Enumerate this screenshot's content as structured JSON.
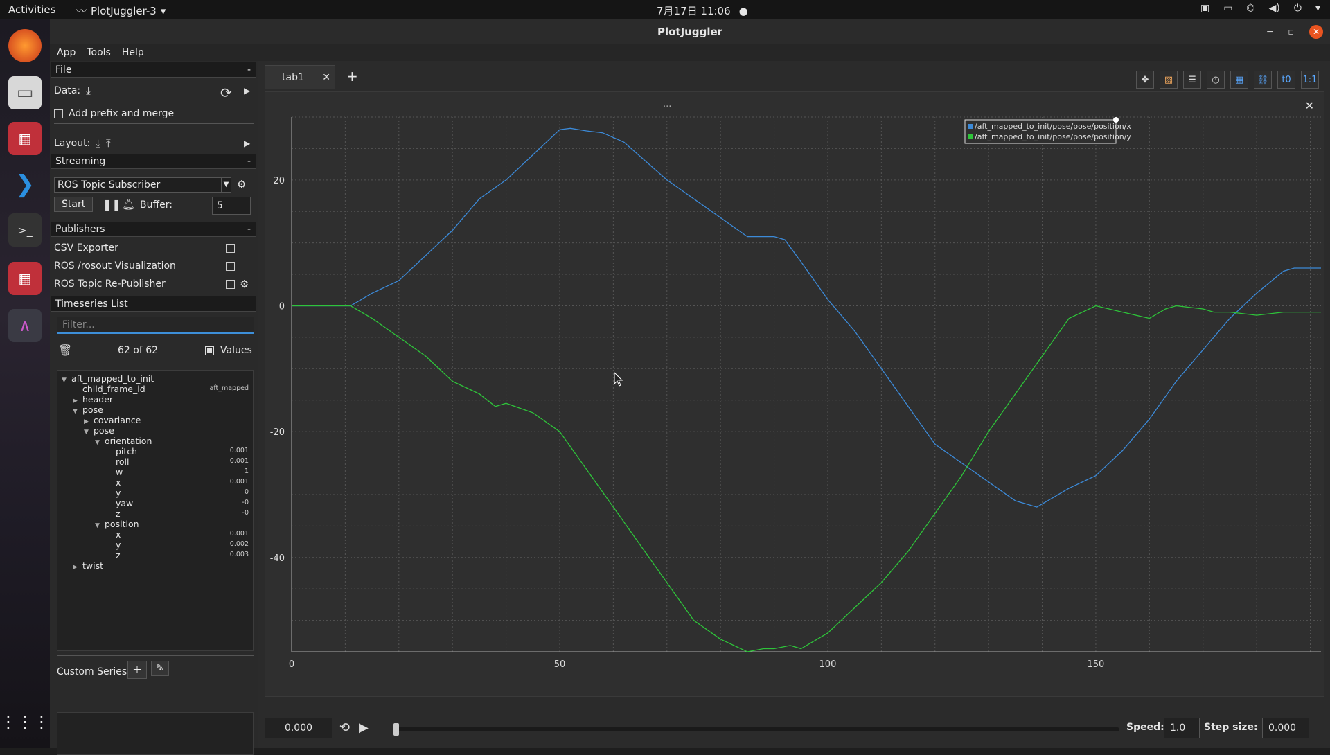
{
  "topbar": {
    "activities": "Activities",
    "app_name": "PlotJuggler-3",
    "clock": "7月17日 11:06"
  },
  "window": {
    "title": "PlotJuggler"
  },
  "menu": [
    "App",
    "Tools",
    "Help"
  ],
  "file_section": {
    "title": "File",
    "collapse": "-",
    "data_label": "Data:",
    "prefix_label": "Add prefix and merge",
    "layout_label": "Layout:"
  },
  "streaming": {
    "title": "Streaming",
    "collapse": "-",
    "source": "ROS Topic Subscriber",
    "start_label": "Start",
    "buffer_label": "Buffer:",
    "buffer_value": "5"
  },
  "publishers": {
    "title": "Publishers",
    "collapse": "-",
    "items": [
      "CSV Exporter",
      "ROS /rosout Visualization",
      "ROS Topic Re-Publisher"
    ]
  },
  "timeseries": {
    "title": "Timeseries List",
    "filter_placeholder": "Filter...",
    "count": "62 of 62",
    "values_label": "Values"
  },
  "tree": [
    {
      "label": "aft_mapped_to_init",
      "level": 0,
      "arrow": "v",
      "value": ""
    },
    {
      "label": "child_frame_id",
      "level": 1,
      "arrow": "",
      "value": "aft_mapped"
    },
    {
      "label": "header",
      "level": 1,
      "arrow": ">",
      "value": ""
    },
    {
      "label": "pose",
      "level": 1,
      "arrow": "v",
      "value": ""
    },
    {
      "label": "covariance",
      "level": 2,
      "arrow": ">",
      "value": ""
    },
    {
      "label": "pose",
      "level": 2,
      "arrow": "v",
      "value": ""
    },
    {
      "label": "orientation",
      "level": 3,
      "arrow": "v",
      "value": ""
    },
    {
      "label": "pitch",
      "level": 4,
      "arrow": "",
      "value": "0.001"
    },
    {
      "label": "roll",
      "level": 4,
      "arrow": "",
      "value": "0.001"
    },
    {
      "label": "w",
      "level": 4,
      "arrow": "",
      "value": "1"
    },
    {
      "label": "x",
      "level": 4,
      "arrow": "",
      "value": "0.001"
    },
    {
      "label": "y",
      "level": 4,
      "arrow": "",
      "value": "0"
    },
    {
      "label": "yaw",
      "level": 4,
      "arrow": "",
      "value": "-0"
    },
    {
      "label": "z",
      "level": 4,
      "arrow": "",
      "value": "-0"
    },
    {
      "label": "position",
      "level": 3,
      "arrow": "v",
      "value": ""
    },
    {
      "label": "x",
      "level": 4,
      "arrow": "",
      "value": "0.001"
    },
    {
      "label": "y",
      "level": 4,
      "arrow": "",
      "value": "0.002"
    },
    {
      "label": "z",
      "level": 4,
      "arrow": "",
      "value": "0.003"
    },
    {
      "label": "twist",
      "level": 1,
      "arrow": ">",
      "value": ""
    }
  ],
  "custom_series": {
    "label": "Custom Series:"
  },
  "tabs": [
    {
      "label": "tab1"
    }
  ],
  "plot_title": "...",
  "chart_data": {
    "type": "line",
    "xlim": [
      0,
      192
    ],
    "ylim": [
      -55,
      30
    ],
    "xticks": [
      0,
      50,
      100,
      150
    ],
    "yticks": [
      20,
      0,
      -20,
      -40
    ],
    "grid": true,
    "legend": "top-right",
    "series": [
      {
        "name": "/aft_mapped_to_init/pose/pose/position/x",
        "color": "#3c8ad8",
        "x": [
          0,
          11,
          15,
          20,
          25,
          30,
          35,
          40,
          45,
          50,
          52,
          55,
          58,
          62,
          70,
          80,
          85,
          90,
          92,
          95,
          100,
          105,
          110,
          115,
          120,
          125,
          130,
          135,
          139,
          145,
          150,
          155,
          160,
          165,
          170,
          175,
          180,
          185,
          187,
          192
        ],
        "y": [
          0,
          0,
          2,
          4,
          8,
          12,
          17,
          20,
          24,
          28,
          28.2,
          27.8,
          27.5,
          26,
          20,
          14,
          11,
          11,
          10.5,
          7,
          1,
          -4,
          -10,
          -16,
          -22,
          -25,
          -28,
          -31,
          -32,
          -29,
          -27,
          -23,
          -18,
          -12,
          -7,
          -2,
          2,
          5.5,
          6,
          6
        ]
      },
      {
        "name": "/aft_mapped_to_init/pose/pose/position/y",
        "color": "#2ec43a",
        "x": [
          0,
          11,
          15,
          20,
          25,
          30,
          35,
          38,
          40,
          45,
          50,
          55,
          60,
          65,
          70,
          75,
          80,
          85,
          88,
          90,
          93,
          95,
          100,
          105,
          110,
          115,
          120,
          125,
          130,
          135,
          140,
          145,
          150,
          155,
          160,
          163,
          165,
          170,
          172,
          175,
          180,
          185,
          192
        ],
        "y": [
          0,
          0,
          -2,
          -5,
          -8,
          -12,
          -14,
          -16,
          -15.5,
          -17,
          -20,
          -26,
          -32,
          -38,
          -44,
          -50,
          -53,
          -55,
          -54.5,
          -54.5,
          -54,
          -54.5,
          -52,
          -48,
          -44,
          -39,
          -33,
          -27,
          -20,
          -14,
          -8,
          -2,
          0,
          -1,
          -2,
          -0.5,
          0,
          -0.5,
          -1,
          -1,
          -1.5,
          -1,
          -1
        ]
      }
    ]
  },
  "bottom": {
    "time_value": "0.000",
    "speed_label": "Speed:",
    "speed_value": "1.0",
    "step_label": "Step size:",
    "step_value": "0.000"
  },
  "toolbar_icons": [
    "move-icon",
    "plot-color-icon",
    "legend-icon",
    "time-icon",
    "grid-icon",
    "link-icon",
    "time-offset-icon",
    "ratio-icon"
  ],
  "toolbar_text": {
    "t0": "t0",
    "ratio": "1:1"
  }
}
